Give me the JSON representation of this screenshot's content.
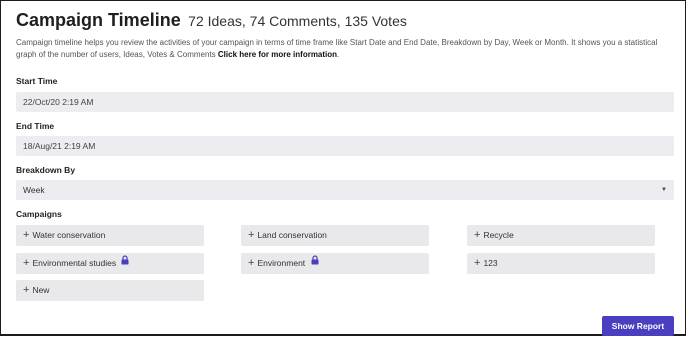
{
  "header": {
    "title": "Campaign Timeline",
    "stats": "72 Ideas, 74 Comments, 135 Votes",
    "description": "Campaign timeline helps you review the activities of your campaign in terms of time frame like Start Date and End Date, Breakdown by Day, Week or Month. It shows you a statistical graph of the number of users, Ideas, Votes & Comments",
    "more_link": "Click here for more information",
    "more_suffix": "."
  },
  "start_time": {
    "label": "Start Time",
    "value": "22/Oct/20 2:19 AM"
  },
  "end_time": {
    "label": "End Time",
    "value": "18/Aug/21 2:19 AM"
  },
  "breakdown": {
    "label": "Breakdown By",
    "selected": "Week"
  },
  "campaigns": {
    "label": "Campaigns",
    "items": [
      {
        "label": "Water conservation",
        "locked": false
      },
      {
        "label": "Land conservation",
        "locked": false
      },
      {
        "label": "Recycle",
        "locked": false
      },
      {
        "label": "Environmental studies",
        "locked": true
      },
      {
        "label": "Environment",
        "locked": true
      },
      {
        "label": "123",
        "locked": false
      },
      {
        "label": "New",
        "locked": false
      }
    ]
  },
  "actions": {
    "show_report": "Show Report"
  },
  "colors": {
    "accent": "#4a3fc0",
    "lock_icon": "#4a3fc0",
    "field_bg": "#ececf1"
  }
}
